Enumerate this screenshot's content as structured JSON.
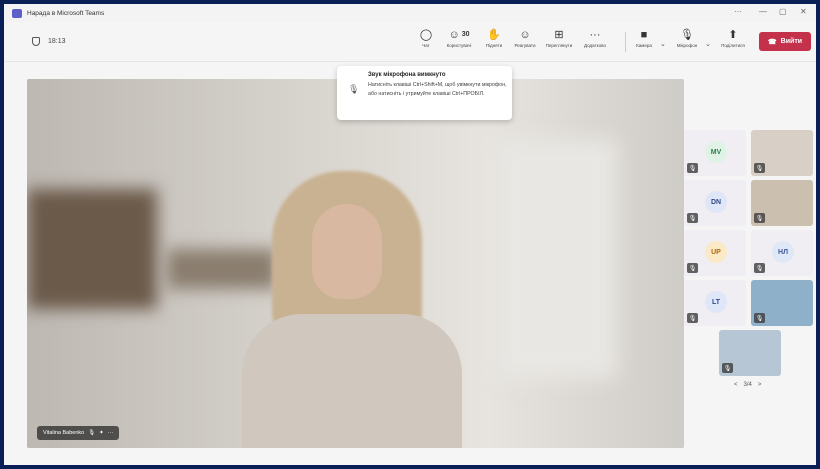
{
  "window": {
    "title": "Нарада в Microsoft Teams",
    "controls": [
      "···",
      "—",
      "▢",
      "✕"
    ]
  },
  "meeting": {
    "timer": "18:13"
  },
  "toolbar": {
    "chat_label": "Чат",
    "people_label": "Користувачі",
    "people_count": "30",
    "raise_label": "Підняти",
    "react_label": "Реагувати",
    "view_label": "Переглянути",
    "more_label": "Додатково",
    "more_icon_text": "···",
    "camera_label": "Камера",
    "mic_label": "Мікрофон",
    "share_label": "Поділитися",
    "leave_label": "Вийти"
  },
  "toast": {
    "title": "Звук мікрофона вимкнуто",
    "body": "Натисніть клавіші Ctrl+Shift+M, щоб увімкнути мікрофон, або натисніть і утримуйте клавіші Ctrl+ПРОБІЛ."
  },
  "stage": {
    "speaker_name": "Vitalina Babenko"
  },
  "participants": [
    {
      "initials": "MV",
      "bg": "#dff3e4",
      "fg": "#2e7d4f"
    },
    {
      "initials": "DN",
      "bg": "#dfe6f7",
      "fg": "#2f4a8a"
    },
    {
      "initials": "UP",
      "bg": "#fbe9c8",
      "fg": "#b06a00"
    },
    {
      "initials": "НЛ",
      "bg": "#dfe8f7",
      "fg": "#3d5a99"
    },
    {
      "initials": "LT",
      "bg": "#dfe6f7",
      "fg": "#2f4a8a"
    }
  ],
  "pager": {
    "prev": "<",
    "label": "3/4",
    "next": ">"
  },
  "colors": {
    "accent": "#5b5fc7",
    "leave": "#c4314b",
    "border": "#0b1f57"
  }
}
